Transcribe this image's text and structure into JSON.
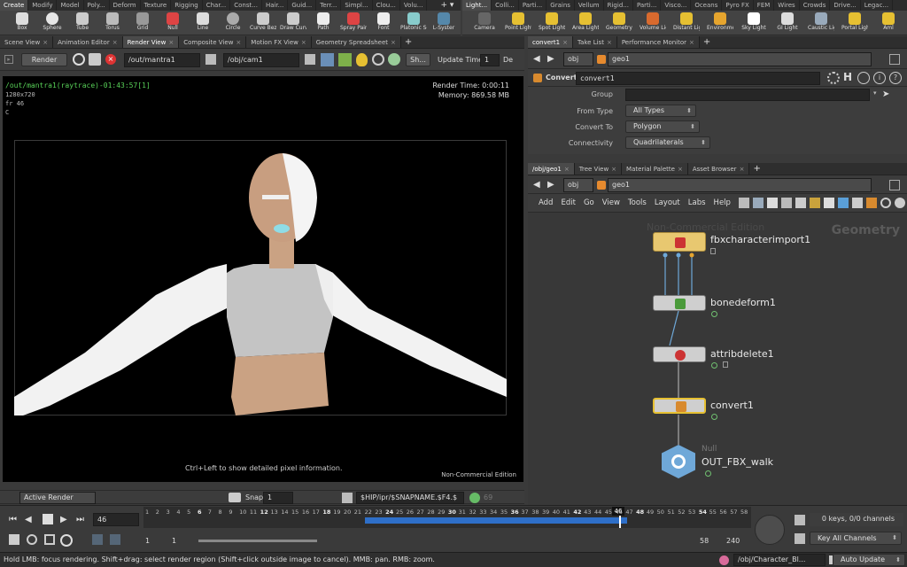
{
  "shelf_tabs_left": [
    "Create",
    "Modify",
    "Model",
    "Poly...",
    "Deform",
    "Texture",
    "Rigging",
    "Char...",
    "Const...",
    "Hair...",
    "Guid...",
    "Terr...",
    "Simpl...",
    "Clou...",
    "Volu..."
  ],
  "shelf_tabs_right": [
    "Light...",
    "Colli...",
    "Parti...",
    "Grains",
    "Vellum",
    "Rigid...",
    "Parti...",
    "Visco...",
    "Oceans",
    "Pyro FX",
    "FEM",
    "Wires",
    "Crowds",
    "Drive...",
    "Legac..."
  ],
  "shelf_tools_left": [
    {
      "label": "Box",
      "icon": "box-icon"
    },
    {
      "label": "Sphere",
      "icon": "sphere-icon"
    },
    {
      "label": "Tube",
      "icon": "tube-icon"
    },
    {
      "label": "Torus",
      "icon": "torus-icon"
    },
    {
      "label": "Grid",
      "icon": "grid-icon"
    },
    {
      "label": "Null",
      "icon": "null-icon"
    },
    {
      "label": "Line",
      "icon": "line-icon"
    },
    {
      "label": "Circle",
      "icon": "circle-icon"
    },
    {
      "label": "Curve Bezier",
      "icon": "curve-bezier-icon"
    },
    {
      "label": "Draw Curve",
      "icon": "draw-curve-icon"
    },
    {
      "label": "Path",
      "icon": "path-icon"
    },
    {
      "label": "Spray Paint",
      "icon": "spray-paint-icon"
    },
    {
      "label": "Font",
      "icon": "font-icon"
    },
    {
      "label": "Platonic Solids",
      "icon": "platonic-icon"
    },
    {
      "label": "L-Syster",
      "icon": "lsystem-icon"
    }
  ],
  "shelf_tools_right": [
    {
      "label": "Camera",
      "icon": "camera-icon"
    },
    {
      "label": "Point Light",
      "icon": "point-light-icon"
    },
    {
      "label": "Spot Light",
      "icon": "spot-light-icon"
    },
    {
      "label": "Area Light",
      "icon": "area-light-icon"
    },
    {
      "label": "Geometry Light",
      "icon": "geometry-light-icon"
    },
    {
      "label": "Volume Light",
      "icon": "volume-light-icon"
    },
    {
      "label": "Distant Light",
      "icon": "distant-light-icon"
    },
    {
      "label": "Environment Light",
      "icon": "environment-light-icon"
    },
    {
      "label": "Sky Light",
      "icon": "sky-light-icon"
    },
    {
      "label": "GI Light",
      "icon": "gi-light-icon"
    },
    {
      "label": "Caustic Light",
      "icon": "caustic-light-icon"
    },
    {
      "label": "Portal Light",
      "icon": "portal-light-icon"
    },
    {
      "label": "Aml",
      "icon": "ambient-light-icon"
    }
  ],
  "left_pane_tabs": [
    "Scene View",
    "Animation Editor",
    "Render View",
    "Composite View",
    "Motion FX View",
    "Geometry Spreadsheet"
  ],
  "render_toolbar": {
    "render_label": "Render",
    "output": "/out/mantra1",
    "camera": "/obj/cam1",
    "sh_label": "Sh...",
    "update_time_label": "Update Time",
    "update_time_value": "1",
    "de_label": "De"
  },
  "viewport": {
    "top_left_title": "/out/mantra1(raytrace)-01:43:57[1]",
    "res": "1280x720",
    "frame": "fr 46",
    "channel": "C",
    "render_time": "Render Time: 0:00:11",
    "memory": "Memory:   869.58 MB",
    "hint": "Ctrl+Left to show detailed pixel information.",
    "watermark": "Non-Commercial Edition"
  },
  "render_bottom": {
    "active_render": "Active Render",
    "snap_label": "Snap",
    "snap_value": "1",
    "snapname": "$HIP/ipr/$SNAPNAME.$F4.$",
    "num": "69"
  },
  "right_top_tabs": [
    "convert1",
    "Take List",
    "Performance Monitor"
  ],
  "path_bar_top": {
    "obj": "obj",
    "geo": "geo1"
  },
  "node_params": {
    "type": "Convert",
    "name": "convert1",
    "rows": [
      {
        "label": "Group",
        "value": ""
      },
      {
        "label": "From Type",
        "value": "All Types"
      },
      {
        "label": "Convert To",
        "value": "Polygon"
      },
      {
        "label": "Connectivity",
        "value": "Quadrilaterals"
      }
    ]
  },
  "right_bottom_tabs": [
    "/obj/geo1",
    "Tree View",
    "Material Palette",
    "Asset Browser"
  ],
  "path_bar_bottom": {
    "obj": "obj",
    "geo": "geo1"
  },
  "network_menu": [
    "Add",
    "Edit",
    "Go",
    "View",
    "Tools",
    "Layout",
    "Labs",
    "Help"
  ],
  "network": {
    "watermark": "Non-Commercial Edition",
    "context": "Geometry",
    "nodes": [
      {
        "name": "fbxcharacterimport1"
      },
      {
        "name": "bonedeform1"
      },
      {
        "name": "attribdelete1"
      },
      {
        "name": "convert1"
      },
      {
        "name": "OUT_FBX_walk",
        "type": "Null"
      }
    ]
  },
  "timeline": {
    "frame_ticks": [
      "1",
      "2",
      "3",
      "4",
      "5",
      "6",
      "7",
      "8",
      "9",
      "10",
      "11",
      "12",
      "13",
      "14",
      "15",
      "16",
      "17",
      "18",
      "19",
      "20",
      "21",
      "22",
      "23",
      "24",
      "25",
      "26",
      "27",
      "28",
      "29",
      "30",
      "31",
      "32",
      "33",
      "34",
      "35",
      "36",
      "37",
      "38",
      "39",
      "40",
      "41",
      "42",
      "43",
      "44",
      "45",
      "46",
      "47",
      "48",
      "49",
      "50",
      "51",
      "52",
      "53",
      "54",
      "55",
      "56",
      "57",
      "58"
    ],
    "current_frame": "46",
    "frame_field": "46",
    "range_start": "1",
    "range_start2": "1",
    "range_end": "58",
    "range_end2": "240",
    "keys": "0 keys, 0/0 channels",
    "key_all": "Key All Channels"
  },
  "status": {
    "message": "Hold LMB: focus rendering. Shift+drag: select render region (Shift+click outside image to cancel). MMB: pan. RMB: zoom.",
    "path": "/obj/Character_Bl...",
    "auto_update": "Auto Update"
  }
}
